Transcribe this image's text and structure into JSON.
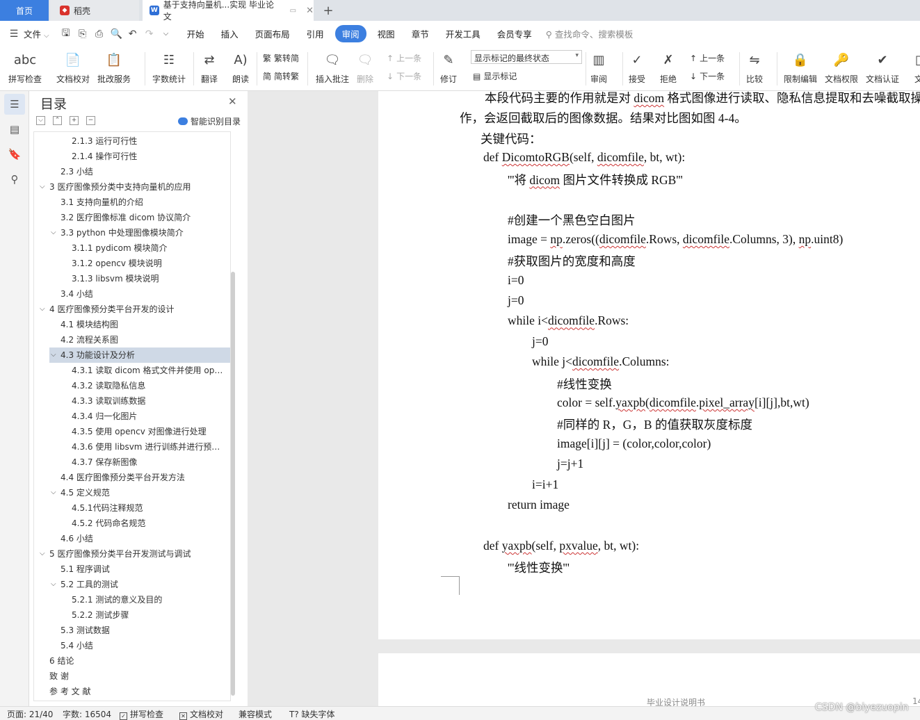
{
  "tabs": {
    "home": "首页",
    "daoke": "稻壳",
    "doc": "基于支持向量机...实现 毕业论文",
    "add": "+"
  },
  "menu": {
    "file": "文件",
    "items": [
      "开始",
      "插入",
      "页面布局",
      "引用",
      "审阅",
      "视图",
      "章节",
      "开发工具",
      "会员专享"
    ],
    "active": "审阅",
    "search": "查找命令、搜索模板"
  },
  "ribbon": {
    "spellcheck": "拼写检查",
    "doc_proof": "文档校对",
    "batch_service": "批改服务",
    "word_count": "字数统计",
    "translate": "翻译",
    "read_aloud": "朗读",
    "trad_simp": "繁转简",
    "simp_trad": "简转繁",
    "insert_comment": "插入批注",
    "delete": "删除",
    "prev_comment": "上一条",
    "next_comment": "下一条",
    "revise": "修订",
    "markup_mode": "显示标记的最终状态",
    "show_markup": "显示标记",
    "review": "审阅",
    "accept": "接受",
    "reject": "拒绝",
    "prev_change": "上一条",
    "next_change": "下一条",
    "compare": "比较",
    "restrict_edit": "限制编辑",
    "doc_rights": "文档权限",
    "doc_cert": "文档认证",
    "doc_more": "文"
  },
  "toc": {
    "title": "目录",
    "smart": "智能识别目录",
    "items": [
      {
        "label": "2.1.3  运行可行性",
        "level": 3
      },
      {
        "label": "2.1.4  操作可行性",
        "level": 3
      },
      {
        "label": "2.3  小结",
        "level": 2
      },
      {
        "label": "3  医疗图像预分类中支持向量机的应用",
        "level": 1,
        "expand": true
      },
      {
        "label": "3.1  支持向量机的介绍",
        "level": 2
      },
      {
        "label": "3.2  医疗图像标准 dicom 协议简介",
        "level": 2
      },
      {
        "label": "3.3 python 中处理图像模块简介",
        "level": 2,
        "expand": true
      },
      {
        "label": "3.1.1 pydicom 模块简介",
        "level": 3
      },
      {
        "label": "3.1.2 opencv 模块说明",
        "level": 3
      },
      {
        "label": "3.1.3 libsvm 模块说明",
        "level": 3
      },
      {
        "label": "3.4  小结",
        "level": 2
      },
      {
        "label": "4  医疗图像预分类平台开发的设计",
        "level": 1,
        "expand": true
      },
      {
        "label": "4.1  模块结构图",
        "level": 2
      },
      {
        "label": "4.2  流程关系图",
        "level": 2
      },
      {
        "label": "4.3  功能设计及分析",
        "level": 2,
        "expand": true,
        "selected": true
      },
      {
        "label": "4.3.1  读取 dicom 格式文件并使用 op…",
        "level": 3
      },
      {
        "label": "4.3.2  读取隐私信息",
        "level": 3
      },
      {
        "label": "4.3.3  读取训练数据",
        "level": 3
      },
      {
        "label": "4.3.4  归一化图片",
        "level": 3
      },
      {
        "label": "4.3.5  使用 opencv 对图像进行处理",
        "level": 3
      },
      {
        "label": "4.3.6  使用 libsvm 进行训练并进行预…",
        "level": 3
      },
      {
        "label": "4.3.7  保存新图像",
        "level": 3
      },
      {
        "label": "4.4  医疗图像预分类平台开发方法",
        "level": 2
      },
      {
        "label": "4.5  定义规范",
        "level": 2,
        "expand": true
      },
      {
        "label": "4.5.1代码注释规范",
        "level": 3
      },
      {
        "label": "4.5.2  代码命名规范",
        "level": 3
      },
      {
        "label": "4.6  小结",
        "level": 2
      },
      {
        "label": "5  医疗图像预分类平台开发测试与调试",
        "level": 1,
        "expand": true
      },
      {
        "label": "5.1  程序调试",
        "level": 2
      },
      {
        "label": "5.2  工具的测试",
        "level": 2,
        "expand": true
      },
      {
        "label": "5.2.1  测试的意义及目的",
        "level": 3
      },
      {
        "label": "5.2.2  测试步骤",
        "level": 3
      },
      {
        "label": "5.3  测试数据",
        "level": 2
      },
      {
        "label": "5.4  小结",
        "level": 2
      },
      {
        "label": "6  结论",
        "level": 1
      },
      {
        "label": "致  谢",
        "level": 1
      },
      {
        "label": "参  考  文  献",
        "level": 1
      }
    ]
  },
  "doc": {
    "lines": [
      {
        "text": "本段代码主要的作用就是对 dicom 格式图像进行读取、隐私信息提取和去噪截取操",
        "indent": 0
      },
      {
        "text": "作，会返回截取后的图像数据。结果对比图如图 4-4。",
        "indent": -1
      },
      {
        "text": "关键代码：",
        "indent": 0
      },
      {
        "text": "def DicomtoRGB(self, dicomfile, bt, wt):",
        "indent": 1
      },
      {
        "text": "'''将 dicom 图片文件转换成 RGB'''",
        "indent": 2
      },
      {
        "text": "",
        "indent": 2
      },
      {
        "text": "#创建一个黑色空白图片",
        "indent": 2
      },
      {
        "text": "image = np.zeros((dicomfile.Rows, dicomfile.Columns, 3), np.uint8)",
        "indent": 2
      },
      {
        "text": "#获取图片的宽度和高度",
        "indent": 2
      },
      {
        "text": "i=0",
        "indent": 2
      },
      {
        "text": "j=0",
        "indent": 2
      },
      {
        "text": "while i<dicomfile.Rows:",
        "indent": 2
      },
      {
        "text": "j=0",
        "indent": 3
      },
      {
        "text": "while j<dicomfile.Columns:",
        "indent": 3
      },
      {
        "text": "#线性变换",
        "indent": 4
      },
      {
        "text": "color = self.yaxpb(dicomfile.pixel_array[i][j],bt,wt)",
        "indent": 4
      },
      {
        "text": "#同样的 R，G，B 的值获取灰度标度",
        "indent": 4
      },
      {
        "text": "image[i][j] = (color,color,color)",
        "indent": 4
      },
      {
        "text": "j=j+1",
        "indent": 4
      },
      {
        "text": "i=i+1",
        "indent": 3
      },
      {
        "text": "return image",
        "indent": 2
      },
      {
        "text": "",
        "indent": 2
      },
      {
        "text": "def yaxpb(self, pxvalue, bt, wt):",
        "indent": 1
      },
      {
        "text": "'''线性变换'''",
        "indent": 2
      }
    ],
    "footer": "毕业设计说明书",
    "page_num": "14"
  },
  "status": {
    "page": "页面: 21/40",
    "words": "字数: 16504",
    "spellcheck": "拼写检查",
    "proof": "文档校对",
    "compat": "兼容模式",
    "missing_font": "缺失字体"
  },
  "watermark": "CSDN @biyezuopin"
}
